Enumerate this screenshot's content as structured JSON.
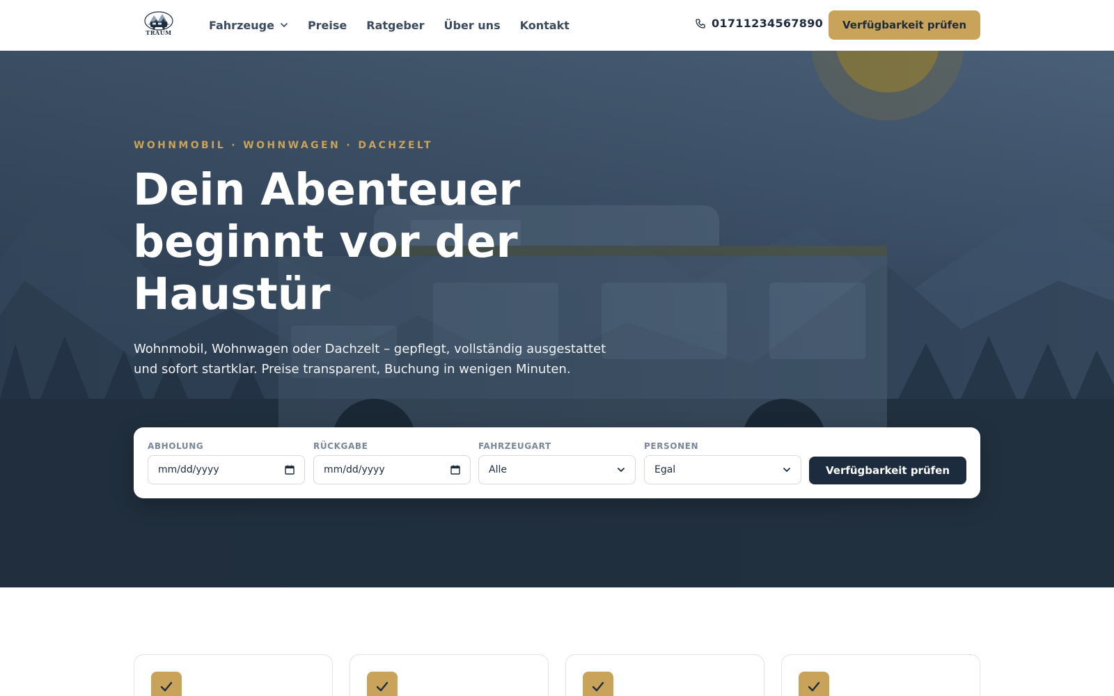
{
  "brand": {
    "logo_text": "TRAUM"
  },
  "nav": {
    "items": [
      {
        "label": "Fahrzeuge",
        "has_dropdown": true
      },
      {
        "label": "Preise"
      },
      {
        "label": "Ratgeber"
      },
      {
        "label": "Über uns"
      },
      {
        "label": "Kontakt"
      }
    ],
    "phone": "01711234567890",
    "cta_label": "Verfügbarkeit prüfen"
  },
  "hero": {
    "eyebrow": "WOHNMOBIL · WOHNWAGEN · DACHZELT",
    "title": "Dein Abenteuer beginnt vor der Haustür",
    "subtitle": "Wohnmobil, Wohnwagen oder Dachzelt – gepflegt, vollständig ausgestattet und sofort startklar. Preise transparent, Buchung in wenigen Minuten."
  },
  "search": {
    "pickup": {
      "label": "ABHOLUNG",
      "placeholder": "mm/dd/yyyy"
    },
    "return": {
      "label": "RÜCKGABE",
      "placeholder": "mm/dd/yyyy"
    },
    "vehicle_type": {
      "label": "FAHRZEUGART",
      "value": "Alle"
    },
    "persons": {
      "label": "PERSONEN",
      "value": "Egal"
    },
    "submit_label": "Verfügbarkeit prüfen"
  },
  "feature_cards": [
    {
      "icon": "check-icon"
    },
    {
      "icon": "check-icon"
    },
    {
      "icon": "check-icon"
    },
    {
      "icon": "check-icon"
    }
  ],
  "colors": {
    "accent": "#c9a35a",
    "navy": "#1c2b3d",
    "hero_top": "#4a6078",
    "hero_bottom": "#1e2b3a"
  }
}
